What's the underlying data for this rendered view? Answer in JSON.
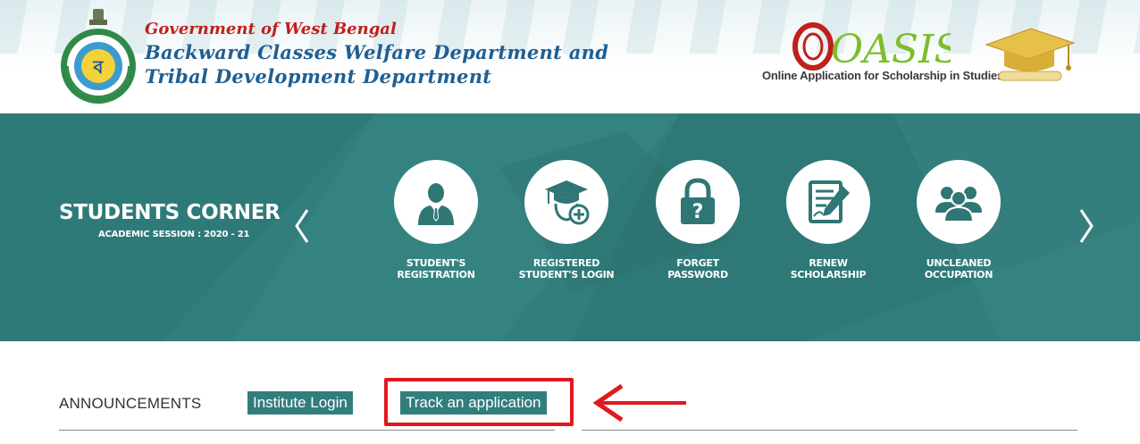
{
  "header": {
    "gov_title": "Government of West Bengal",
    "dept_line_1": "Backward Classes Welfare Department and",
    "dept_line_2": "Tribal Development Department",
    "oasis_logo_text": "OASIS",
    "oasis_tagline": "Online Application for Scholarship in Studies"
  },
  "banner": {
    "title": "STUDENTS CORNER",
    "session": "ACADEMIC SESSION : 2020 - 21",
    "tiles": [
      {
        "line1": "STUDENT'S",
        "line2": "REGISTRATION",
        "icon": "student-icon"
      },
      {
        "line1": "REGISTERED",
        "line2": "STUDENT'S LOGIN",
        "icon": "graduate-login-icon"
      },
      {
        "line1": "FORGET",
        "line2": "PASSWORD",
        "icon": "lock-icon"
      },
      {
        "line1": "RENEW",
        "line2": "SCHOLARSHIP",
        "icon": "form-edit-icon"
      },
      {
        "line1": "UNCLEANED",
        "line2": "OCCUPATION",
        "icon": "group-icon"
      }
    ]
  },
  "tabs": {
    "announcements": "ANNOUNCEMENTS",
    "institute_login": "Institute Login",
    "track_application": "Track an application"
  },
  "colors": {
    "teal": "#317e7c",
    "gov_red": "#c0201c",
    "dept_blue": "#1f5f93",
    "highlight_red": "#e0191f"
  }
}
